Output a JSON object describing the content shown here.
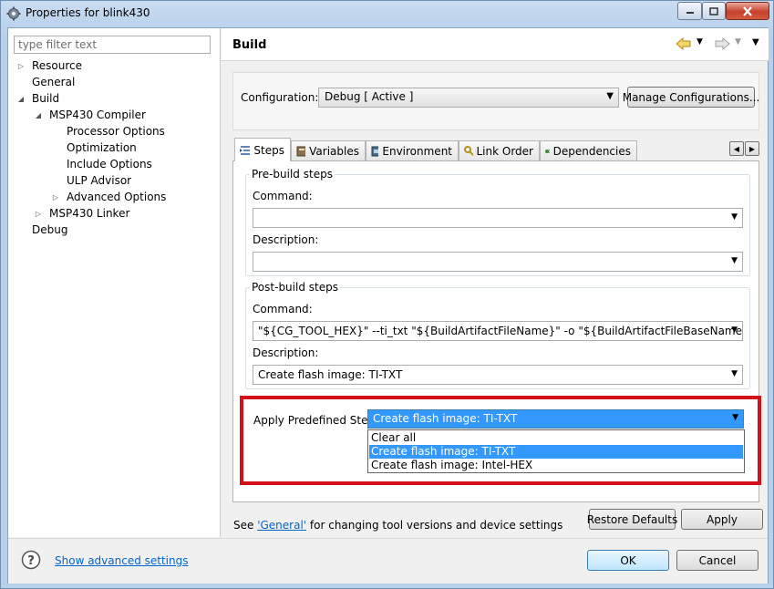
{
  "window": {
    "title": "Properties for blink430",
    "icon": "gear-icon"
  },
  "left": {
    "filter_placeholder": "type filter text",
    "tree": [
      {
        "label": "Resource",
        "twisty": "▷"
      },
      {
        "label": "General",
        "twisty": ""
      },
      {
        "label": "Build",
        "twisty": "◢"
      },
      {
        "label": "MSP430 Compiler",
        "twisty": "◢"
      },
      {
        "label": "Processor Options",
        "twisty": ""
      },
      {
        "label": "Optimization",
        "twisty": ""
      },
      {
        "label": "Include Options",
        "twisty": ""
      },
      {
        "label": "ULP Advisor",
        "twisty": ""
      },
      {
        "label": "Advanced Options",
        "twisty": "▷"
      },
      {
        "label": "MSP430 Linker",
        "twisty": "▷"
      },
      {
        "label": "Debug",
        "twisty": ""
      }
    ]
  },
  "header": {
    "title": "Build"
  },
  "config": {
    "label": "Configuration:",
    "value": "Debug  [ Active ]",
    "manage_label": "Manage Configurations..."
  },
  "tabs": [
    {
      "label": "Steps",
      "icon": "steps-icon"
    },
    {
      "label": "Variables",
      "icon": "variables-icon"
    },
    {
      "label": "Environment",
      "icon": "environment-icon"
    },
    {
      "label": "Link Order",
      "icon": "link-order-icon"
    },
    {
      "label": "Dependencies",
      "icon": "dependencies-icon"
    }
  ],
  "prebuild": {
    "legend": "Pre-build steps",
    "command_label": "Command:",
    "command_value": "",
    "description_label": "Description:",
    "description_value": ""
  },
  "postbuild": {
    "legend": "Post-build steps",
    "command_label": "Command:",
    "command_value": "\"${CG_TOOL_HEX}\" --ti_txt \"${BuildArtifactFileName}\" -o \"${BuildArtifactFileBaseName}.txt\" -orde",
    "description_label": "Description:",
    "description_value": "Create flash image: TI-TXT"
  },
  "predefined": {
    "label": "Apply Predefined Step:",
    "value": "Create flash image: TI-TXT",
    "options": [
      "Clear all",
      "Create flash image: TI-TXT",
      "Create flash image: Intel-HEX"
    ],
    "selected_index": 1
  },
  "footer_note": {
    "prefix": "See ",
    "link": "'General'",
    "suffix": " for changing tool versions and device settings"
  },
  "buttons": {
    "restore_defaults": "Restore Defaults",
    "apply": "Apply",
    "ok": "OK",
    "cancel": "Cancel",
    "show_advanced": "Show advanced settings"
  },
  "colors": {
    "highlight": "#d2111b",
    "selection": "#3399ff",
    "link": "#0066cc"
  }
}
